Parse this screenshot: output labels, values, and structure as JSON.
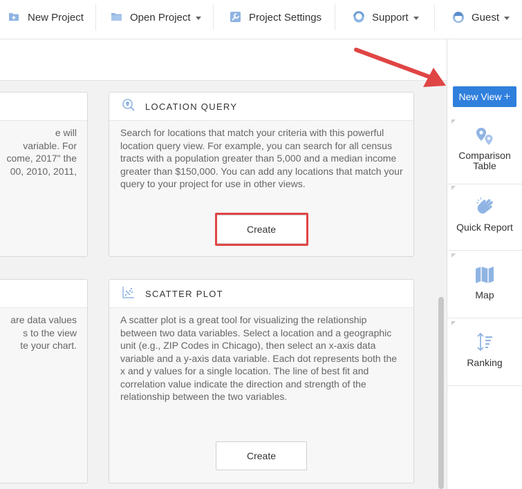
{
  "nav": {
    "new_project": "New Project",
    "open_project": "Open Project",
    "project_settings": "Project Settings",
    "support": "Support",
    "guest": "Guest"
  },
  "cards": {
    "left_top_fragment": [
      "e will",
      "variable. For",
      "come, 2017\" the",
      "00, 2010, 2011,"
    ],
    "left_bottom_fragment": [
      "are data values",
      "s to the view",
      "te your chart."
    ],
    "location_query": {
      "title": "LOCATION QUERY",
      "description": "Search for locations that match your criteria with this powerful location query view. For example, you can search for all census tracts with a population greater than 5,000 and a median income greater than $150,000. You can add any locations that match your query to your project for use in other views.",
      "button": "Create"
    },
    "scatter_plot": {
      "title": "SCATTER PLOT",
      "description": "A scatter plot is a great tool for visualizing the relationship between two data variables. Select a location and a geographic unit (e.g., ZIP Codes in Chicago), then select an x-axis data variable and a y-axis data variable. Each dot represents both the x and y values for a single location. The line of best fit and correlation value indicate the direction and strength of the relationship between the two variables.",
      "button": "Create"
    }
  },
  "right_panel": {
    "new_view": "New View",
    "plus": "+",
    "items": [
      {
        "label_line1": "Comparison",
        "label_line2": "Table"
      },
      {
        "label_line1": "Quick Report"
      },
      {
        "label_line1": "Map"
      },
      {
        "label_line1": "Ranking"
      }
    ]
  },
  "colors": {
    "primary": "#2f7fdc",
    "icon_blue": "#8fb4e3",
    "highlight_red": "#e04545"
  }
}
